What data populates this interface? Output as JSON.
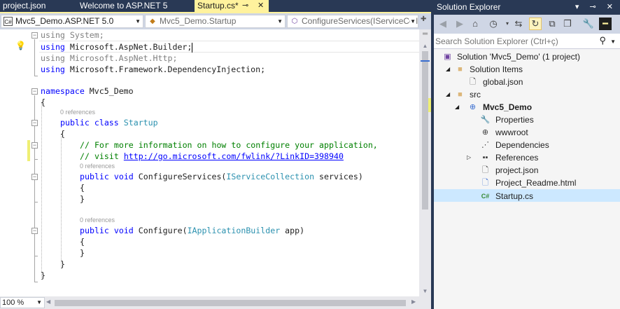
{
  "tabs": [
    {
      "label": "project.json"
    },
    {
      "label": "Welcome to ASP.NET 5"
    },
    {
      "label": "Startup.cs*",
      "pin_icon": "⊸",
      "close_icon": "✕"
    }
  ],
  "nav": {
    "project": "Mvc5_Demo.ASP.NET 5.0",
    "type": "Mvc5_Demo.Startup",
    "member": "ConfigureServices(IServiceColle"
  },
  "code": {
    "line1": {
      "kw": "using",
      "rest": " System;"
    },
    "line2": {
      "kw": "using",
      "rest": " Microsoft.AspNet.Builder;"
    },
    "line3": {
      "kw": "using",
      "rest": " Microsoft.AspNet.Http;"
    },
    "line4": {
      "kw": "using",
      "rest": " Microsoft.Framework.DependencyInjection;"
    },
    "ns_kw": "namespace",
    "ns_name": " Mvc5_Demo",
    "brace_open": "{",
    "brace_close": "}",
    "refs": "0 references",
    "class_kw": "public class",
    "class_name": "Startup",
    "comment1": "// For more information on how to configure your application,",
    "comment2_pre": "// visit ",
    "comment2_link": "http://go.microsoft.com/fwlink/?LinkID=398940",
    "cs_kw": "public void",
    "cs_name": " ConfigureServices(",
    "cs_type": "IServiceCollection",
    "cs_rest": " services)",
    "cfg_kw": "public void",
    "cfg_name": " Configure(",
    "cfg_type": "IApplicationBuilder",
    "cfg_rest": " app)"
  },
  "status": {
    "zoom": "100 %"
  },
  "solution_explorer": {
    "title": "Solution Explorer",
    "title_buttons": "▾ ⊸ ✕",
    "search_placeholder": "Search Solution Explorer (Ctrl+ç)",
    "tree": [
      {
        "label": "Solution 'Mvc5_Demo' (1 project)"
      },
      {
        "label": "Solution Items"
      },
      {
        "label": "global.json"
      },
      {
        "label": "src"
      },
      {
        "label": "Mvc5_Demo"
      },
      {
        "label": "Properties"
      },
      {
        "label": "wwwroot"
      },
      {
        "label": "Dependencies"
      },
      {
        "label": "References"
      },
      {
        "label": "project.json"
      },
      {
        "label": "Project_Readme.html"
      },
      {
        "label": "Startup.cs"
      }
    ]
  },
  "icons": {
    "back": "back-arrow-icon",
    "forward": "forward-arrow-icon",
    "home": "home-icon",
    "history": "history-icon",
    "sync": "sync-icon",
    "refresh": "refresh-icon",
    "collapse": "collapse-all-icon",
    "show_all": "show-all-files-icon",
    "properties": "wrench-icon",
    "pin": "pin-icon"
  },
  "colors": {
    "tab_active": "#fff29d",
    "chrome": "#293955",
    "selection": "#cce8ff"
  }
}
